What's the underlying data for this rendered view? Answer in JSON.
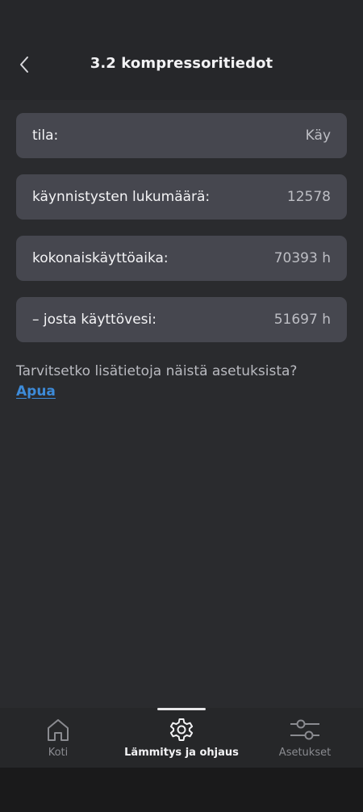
{
  "header": {
    "title": "3.2 kompressoritiedot",
    "back_icon": "chevron-left-icon"
  },
  "rows": [
    {
      "label": "tila:",
      "value": "Käy"
    },
    {
      "label": "käynnistysten lukumäärä:",
      "value": "12578"
    },
    {
      "label": "kokonaiskäyttöaika:",
      "value": "70393 h"
    },
    {
      "label": "– josta käyttövesi:",
      "value": "51697 h"
    }
  ],
  "help": {
    "text": "Tarvitsetko lisätietoja näistä asetuksista?",
    "link": "Apua"
  },
  "nav": {
    "items": [
      {
        "label": "Koti",
        "icon": "home-icon",
        "active": false
      },
      {
        "label": "Lämmitys ja ohjaus",
        "icon": "gear-icon",
        "active": true
      },
      {
        "label": "Asetukset",
        "icon": "sliders-icon",
        "active": false
      }
    ]
  },
  "colors": {
    "background": "#2a2b2e",
    "row": "#46474f",
    "link": "#3d8bd9",
    "nav_active": "#f2f2f4",
    "nav_inactive": "#8a8b90"
  }
}
